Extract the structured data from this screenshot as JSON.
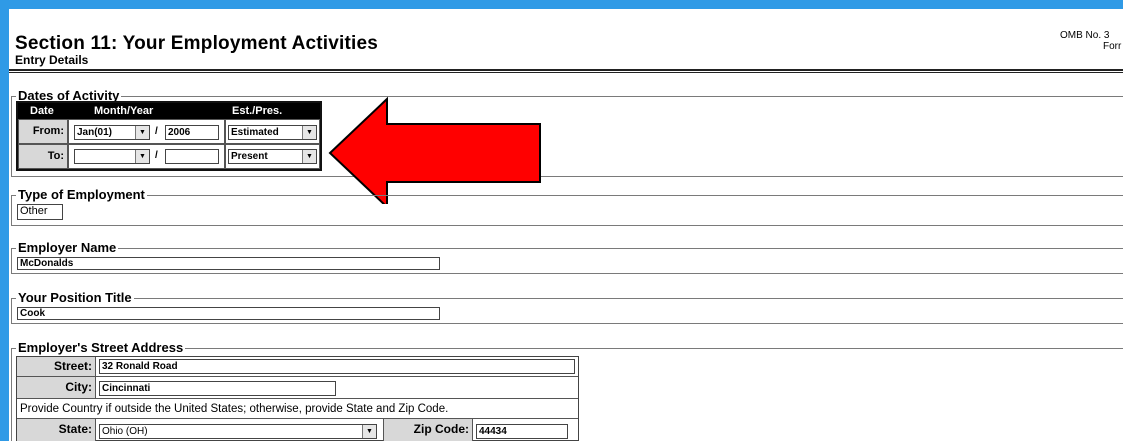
{
  "header": {
    "title": "Section 11: Your Employment Activities",
    "subtitle": "Entry Details",
    "omb_line1": "OMB No. 3",
    "omb_line2": "Forr"
  },
  "dates": {
    "legend": "Dates of Activity",
    "col_date": "Date",
    "col_month_year": "Month/Year",
    "col_est_pres": "Est./Pres.",
    "from_label": "From:",
    "from_month": "Jan(01)",
    "from_year": "2006",
    "from_estimate": "Estimated",
    "to_label": "To:",
    "to_month": "",
    "to_year": "",
    "to_estimate": "Present",
    "slash": "/"
  },
  "employment_type": {
    "legend": "Type of Employment",
    "value": "Other"
  },
  "employer_name": {
    "legend": "Employer Name",
    "value": "McDonalds"
  },
  "position_title": {
    "legend": "Your Position Title",
    "value": "Cook"
  },
  "address": {
    "legend": "Employer's Street Address",
    "street_label": "Street:",
    "street_value": "32 Ronald Road",
    "city_label": "City:",
    "city_value": "Cincinnati",
    "note": "Provide Country if outside the United States; otherwise, provide State and Zip Code.",
    "state_label": "State:",
    "state_value": "Ohio (OH)",
    "zip_label": "Zip Code:",
    "zip_value": "44434"
  },
  "colors": {
    "frame": "#2f9ae6",
    "arrow_fill": "#ff0000",
    "table_header": "#000000"
  }
}
